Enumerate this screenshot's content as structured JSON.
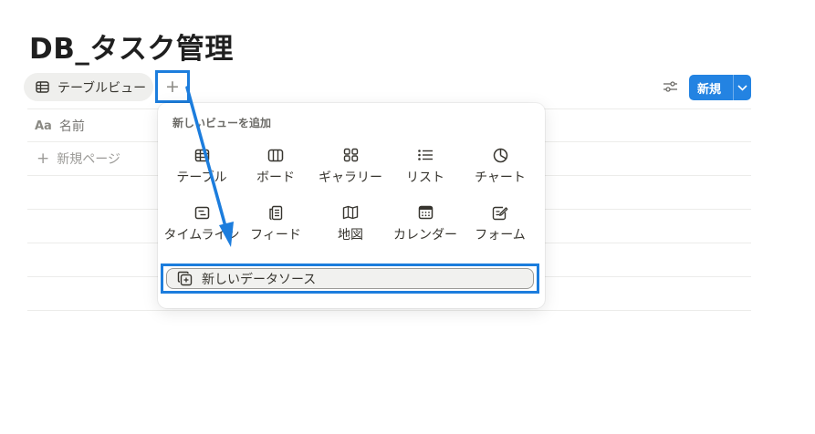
{
  "page": {
    "title": "DB_タスク管理"
  },
  "views": {
    "active_tab": "テーブルビュー",
    "add_symbol": "+"
  },
  "toolbar": {
    "new_label": "新規",
    "accent_color": "#2383e2"
  },
  "table": {
    "name_column": "名前",
    "name_column_icon": "Aa",
    "new_page": "新規ページ"
  },
  "menu": {
    "heading": "新しいビューを追加",
    "options": [
      {
        "label": "テーブル",
        "icon": "table-icon"
      },
      {
        "label": "ボード",
        "icon": "board-icon"
      },
      {
        "label": "ギャラリー",
        "icon": "gallery-icon"
      },
      {
        "label": "リスト",
        "icon": "list-icon"
      },
      {
        "label": "チャート",
        "icon": "chart-icon"
      },
      {
        "label": "タイムライン",
        "icon": "timeline-icon"
      },
      {
        "label": "フィード",
        "icon": "feed-icon"
      },
      {
        "label": "地図",
        "icon": "map-icon"
      },
      {
        "label": "カレンダー",
        "icon": "calendar-icon"
      },
      {
        "label": "フォーム",
        "icon": "form-icon"
      }
    ],
    "new_source": "新しいデータソース"
  },
  "annotation": {
    "highlight_color": "#1c7ddd"
  }
}
